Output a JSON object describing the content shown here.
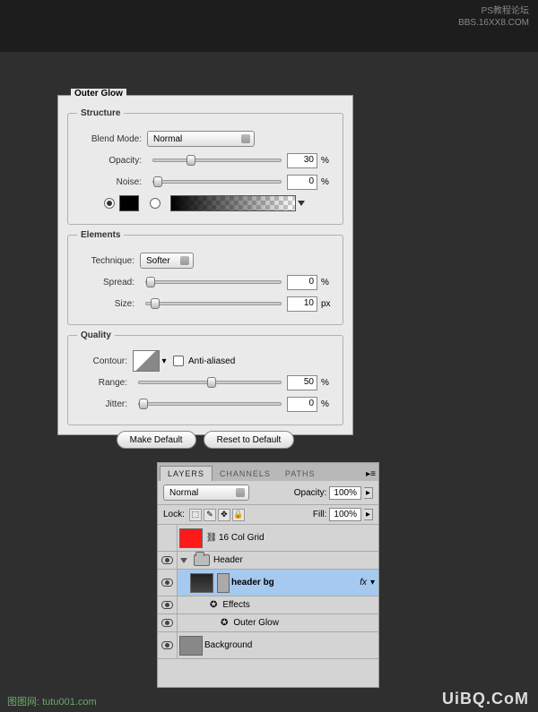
{
  "watermark": {
    "top_line1": "PS教程论坛",
    "top_line2": "BBS.16XX8.COM",
    "bottom_right": "UiBQ.CoM",
    "bottom_left": "图图网: tutu001.com"
  },
  "outerGlow": {
    "title": "Outer Glow",
    "structure": {
      "legend": "Structure",
      "blend_mode_label": "Blend Mode:",
      "blend_mode_value": "Normal",
      "opacity_label": "Opacity:",
      "opacity_value": "30",
      "opacity_unit": "%",
      "noise_label": "Noise:",
      "noise_value": "0",
      "noise_unit": "%"
    },
    "elements": {
      "legend": "Elements",
      "technique_label": "Technique:",
      "technique_value": "Softer",
      "spread_label": "Spread:",
      "spread_value": "0",
      "spread_unit": "%",
      "size_label": "Size:",
      "size_value": "10",
      "size_unit": "px"
    },
    "quality": {
      "legend": "Quality",
      "contour_label": "Contour:",
      "aa_label": "Anti-aliased",
      "range_label": "Range:",
      "range_value": "50",
      "range_unit": "%",
      "jitter_label": "Jitter:",
      "jitter_value": "0",
      "jitter_unit": "%"
    },
    "buttons": {
      "make_default": "Make Default",
      "reset": "Reset to Default"
    }
  },
  "layers": {
    "tabs": {
      "layers": "LAYERS",
      "channels": "CHANNELS",
      "paths": "PATHS"
    },
    "blend_mode": "Normal",
    "opacity_label": "Opacity:",
    "opacity_value": "100%",
    "lock_label": "Lock:",
    "fill_label": "Fill:",
    "fill_value": "100%",
    "items": {
      "grid": "16 Col Grid",
      "header": "Header",
      "header_bg": "header bg",
      "effects": "Effects",
      "outer_glow": "Outer Glow",
      "background": "Background"
    },
    "fx": "fx"
  }
}
